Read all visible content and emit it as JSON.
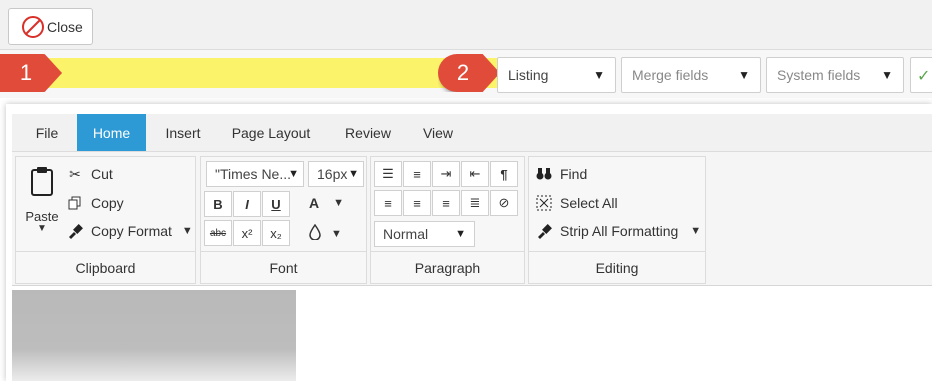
{
  "toolbar": {
    "close_label": "Close"
  },
  "markers": {
    "one": "1",
    "two": "2"
  },
  "fields": {
    "listing": "Listing",
    "merge_fields": "Merge fields",
    "system_fields": "System fields"
  },
  "tabs": [
    {
      "label": "File"
    },
    {
      "label": "Home"
    },
    {
      "label": "Insert"
    },
    {
      "label": "Page Layout"
    },
    {
      "label": "Review"
    },
    {
      "label": "View"
    }
  ],
  "ribbon": {
    "clipboard": {
      "label": "Clipboard",
      "paste": "Paste",
      "cut": "Cut",
      "copy": "Copy",
      "copy_format": "Copy Format"
    },
    "font": {
      "label": "Font",
      "family": "\"Times Ne...",
      "size": "16px",
      "bold": "B",
      "italic": "I",
      "underline": "U",
      "color": "A",
      "strikethrough": "abc",
      "superscript": "x²",
      "subscript": "x₂"
    },
    "paragraph": {
      "label": "Paragraph",
      "style": "Normal"
    },
    "editing": {
      "label": "Editing",
      "find": "Find",
      "select_all": "Select All",
      "strip_formatting": "Strip All Formatting"
    }
  },
  "colors": {
    "accent": "#2e9ad5",
    "marker": "#e14b3a",
    "highlight": "#fbf36a"
  }
}
